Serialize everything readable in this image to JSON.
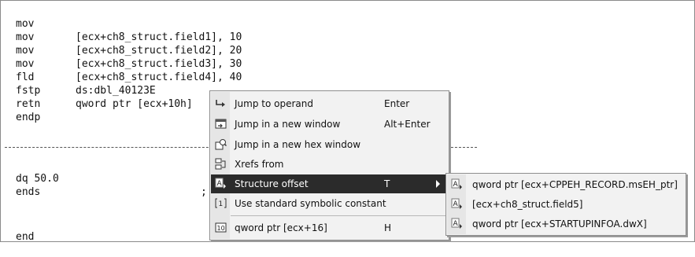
{
  "code_lines": [
    {
      "mnemonic": "mov",
      "operand": "[ecx+ch8_struct.field1], 10"
    },
    {
      "mnemonic": "mov",
      "operand": "[ecx+ch8_struct.field2], 20"
    },
    {
      "mnemonic": "mov",
      "operand": "[ecx+ch8_struct.field3], 30"
    },
    {
      "mnemonic": "mov",
      "operand": "[ecx+ch8_struct.field4], 40"
    },
    {
      "mnemonic": "fld",
      "operand": "ds:dbl_40123E"
    },
    {
      "mnemonic": "fstp",
      "operand": "qword ptr [ecx+10h]"
    },
    {
      "mnemonic": "retn",
      "operand": ""
    },
    {
      "mnemonic": "endp",
      "operand": ""
    }
  ],
  "lower_lines": [
    {
      "mnemonic": "dq 50.0",
      "operand": ";"
    },
    {
      "mnemonic": "ends",
      "operand": ""
    },
    {
      "mnemonic": "end",
      "operand": ""
    }
  ],
  "context_menu": {
    "items": [
      {
        "label": "Jump to operand",
        "shortcut": "Enter",
        "icon": "jump-arrow-icon"
      },
      {
        "label": "Jump in a new window",
        "shortcut": "Alt+Enter",
        "icon": "new-window-icon"
      },
      {
        "label": "Jump in a new hex window",
        "shortcut": "",
        "icon": "hex-window-icon"
      },
      {
        "label": "Xrefs from",
        "shortcut": "",
        "icon": "xrefs-icon"
      },
      {
        "label": "Structure offset",
        "shortcut": "T",
        "icon": "structure-offset-icon"
      },
      {
        "label": "Use standard symbolic constant",
        "shortcut": "",
        "icon": "symbolic-constant-icon"
      },
      {
        "label": "qword ptr [ecx+16]",
        "shortcut": "H",
        "icon": "decimal-icon"
      }
    ]
  },
  "submenu": {
    "items": [
      {
        "label": "qword ptr [ecx+CPPEH_RECORD.msEH_ptr]"
      },
      {
        "label": "[ecx+ch8_struct.field5]"
      },
      {
        "label": "qword ptr [ecx+STARTUPINFOA.dwX]"
      }
    ]
  }
}
